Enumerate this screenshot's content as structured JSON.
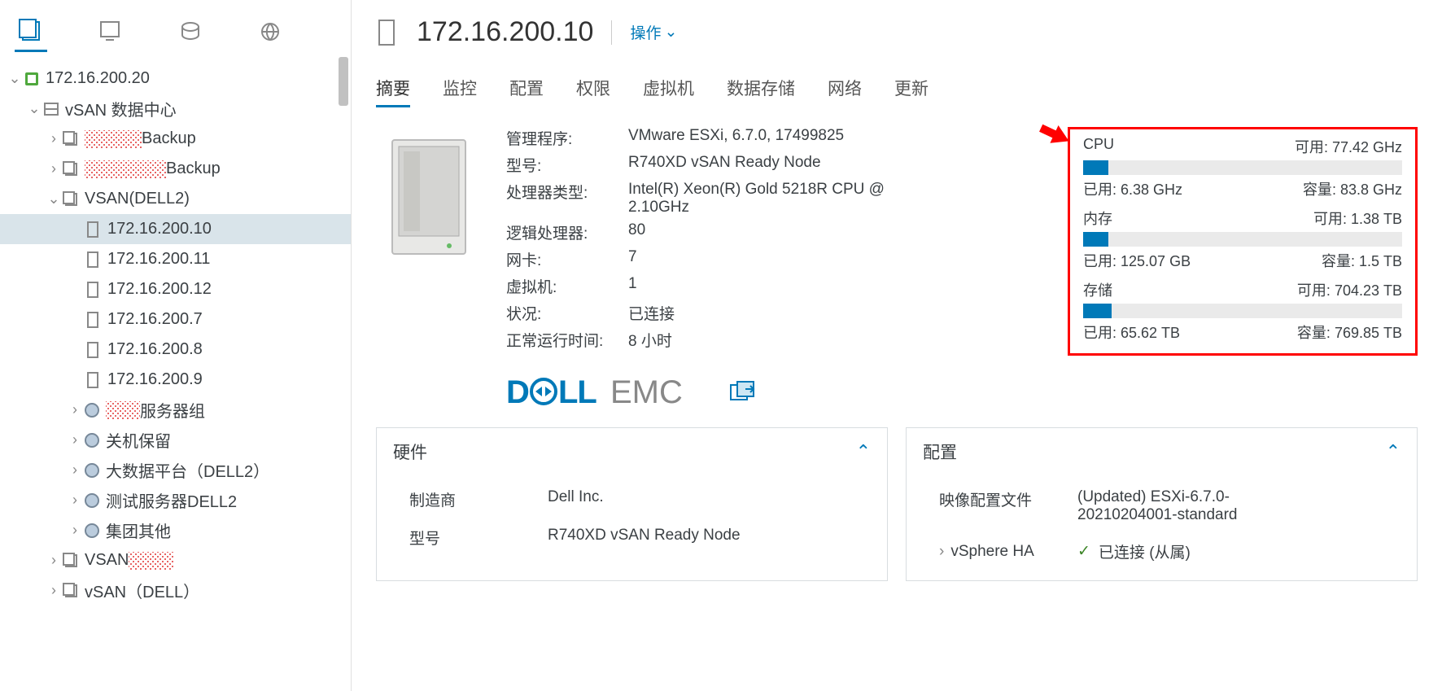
{
  "sidebar": {
    "root_ip": "172.16.200.20",
    "datacenter": "vSAN 数据中心",
    "items": [
      {
        "label": "Backup",
        "type": "vapp",
        "caret": ">",
        "redact": true
      },
      {
        "label": "Backup",
        "type": "vapp",
        "caret": ">",
        "redact": true
      },
      {
        "label": "VSAN(DELL2)",
        "type": "vapp",
        "caret": "v",
        "redact": false
      }
    ],
    "hosts": [
      "172.16.200.10",
      "172.16.200.11",
      "172.16.200.12",
      "172.16.200.7",
      "172.16.200.8",
      "172.16.200.9"
    ],
    "pools": [
      {
        "label": "服务器组",
        "redact": true
      },
      {
        "label": "关机保留",
        "redact": false
      },
      {
        "label": "大数据平台（DELL2）",
        "redact": false
      },
      {
        "label": "测试服务器DELL2",
        "redact": false
      },
      {
        "label": "集团其他",
        "redact": false
      }
    ],
    "vapps_bottom": [
      {
        "label": "VSAN",
        "redact": true
      },
      {
        "label": "vSAN（DELL）",
        "redact": false
      }
    ]
  },
  "header": {
    "title": "172.16.200.10",
    "actions": "操作"
  },
  "tabs": [
    "摘要",
    "监控",
    "配置",
    "权限",
    "虚拟机",
    "数据存储",
    "网络",
    "更新"
  ],
  "summary": {
    "labels": {
      "hypervisor": "管理程序:",
      "model": "型号:",
      "cpu_type": "处理器类型:",
      "logical_cpu": "逻辑处理器:",
      "nics": "网卡:",
      "vms": "虚拟机:",
      "state": "状况:",
      "uptime": "正常运行时间:"
    },
    "values": {
      "hypervisor": "VMware ESXi, 6.7.0, 17499825",
      "model": "R740XD vSAN Ready Node",
      "cpu_type": "Intel(R) Xeon(R) Gold 5218R CPU @ 2.10GHz",
      "logical_cpu": "80",
      "nics": "7",
      "vms": "1",
      "state": "已连接",
      "uptime": "8 小时"
    }
  },
  "metrics": {
    "cpu": {
      "title": "CPU",
      "avail_label": "可用",
      "avail": "77.42 GHz",
      "used_label": "已用",
      "used": "6.38 GHz",
      "cap_label": "容量",
      "cap": "83.8 GHz",
      "pct": 8
    },
    "mem": {
      "title": "内存",
      "avail_label": "可用",
      "avail": "1.38 TB",
      "used_label": "已用",
      "used": "125.07 GB",
      "cap_label": "容量",
      "cap": "1.5 TB",
      "pct": 8
    },
    "storage": {
      "title": "存储",
      "avail_label": "可用",
      "avail": "704.23 TB",
      "used_label": "已用",
      "used": "65.62 TB",
      "cap_label": "容量",
      "cap": "769.85 TB",
      "pct": 9
    }
  },
  "brand": "DELL EMC",
  "cards": {
    "hardware": {
      "title": "硬件",
      "rows": [
        {
          "k": "制造商",
          "v": "Dell Inc."
        },
        {
          "k": "型号",
          "v": "R740XD vSAN Ready Node"
        }
      ]
    },
    "config": {
      "title": "配置",
      "rows": [
        {
          "k": "映像配置文件",
          "v": "(Updated) ESXi-6.7.0-20210204001-standard"
        }
      ],
      "ha_label": "vSphere HA",
      "ha_status": "已连接 (从属)"
    }
  }
}
